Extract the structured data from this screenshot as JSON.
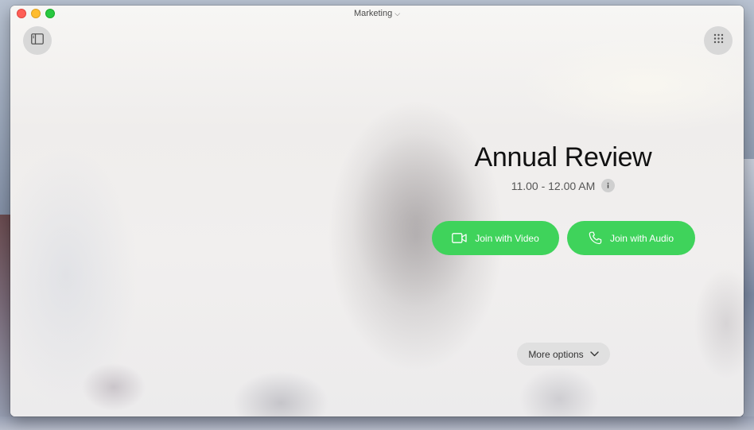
{
  "window": {
    "title": "Marketing",
    "title_chevron": "⌵"
  },
  "meeting": {
    "title": "Annual Review",
    "time": "11.00 - 12.00 AM"
  },
  "actions": {
    "join_video_label": "Join with Video",
    "join_audio_label": "Join with Audio",
    "more_options_label": "More options"
  },
  "icons": {
    "sidebar_toggle": "sidebar-icon",
    "apps_grid": "grid-icon",
    "info": "info-icon",
    "video": "video-camera-icon",
    "audio": "phone-icon",
    "more_chevron": "chevron-down-icon"
  },
  "colors": {
    "join_button": "#3fd35b",
    "traffic_close": "#fe5f57",
    "traffic_minimize": "#febc2e",
    "traffic_maximize": "#28c840"
  }
}
